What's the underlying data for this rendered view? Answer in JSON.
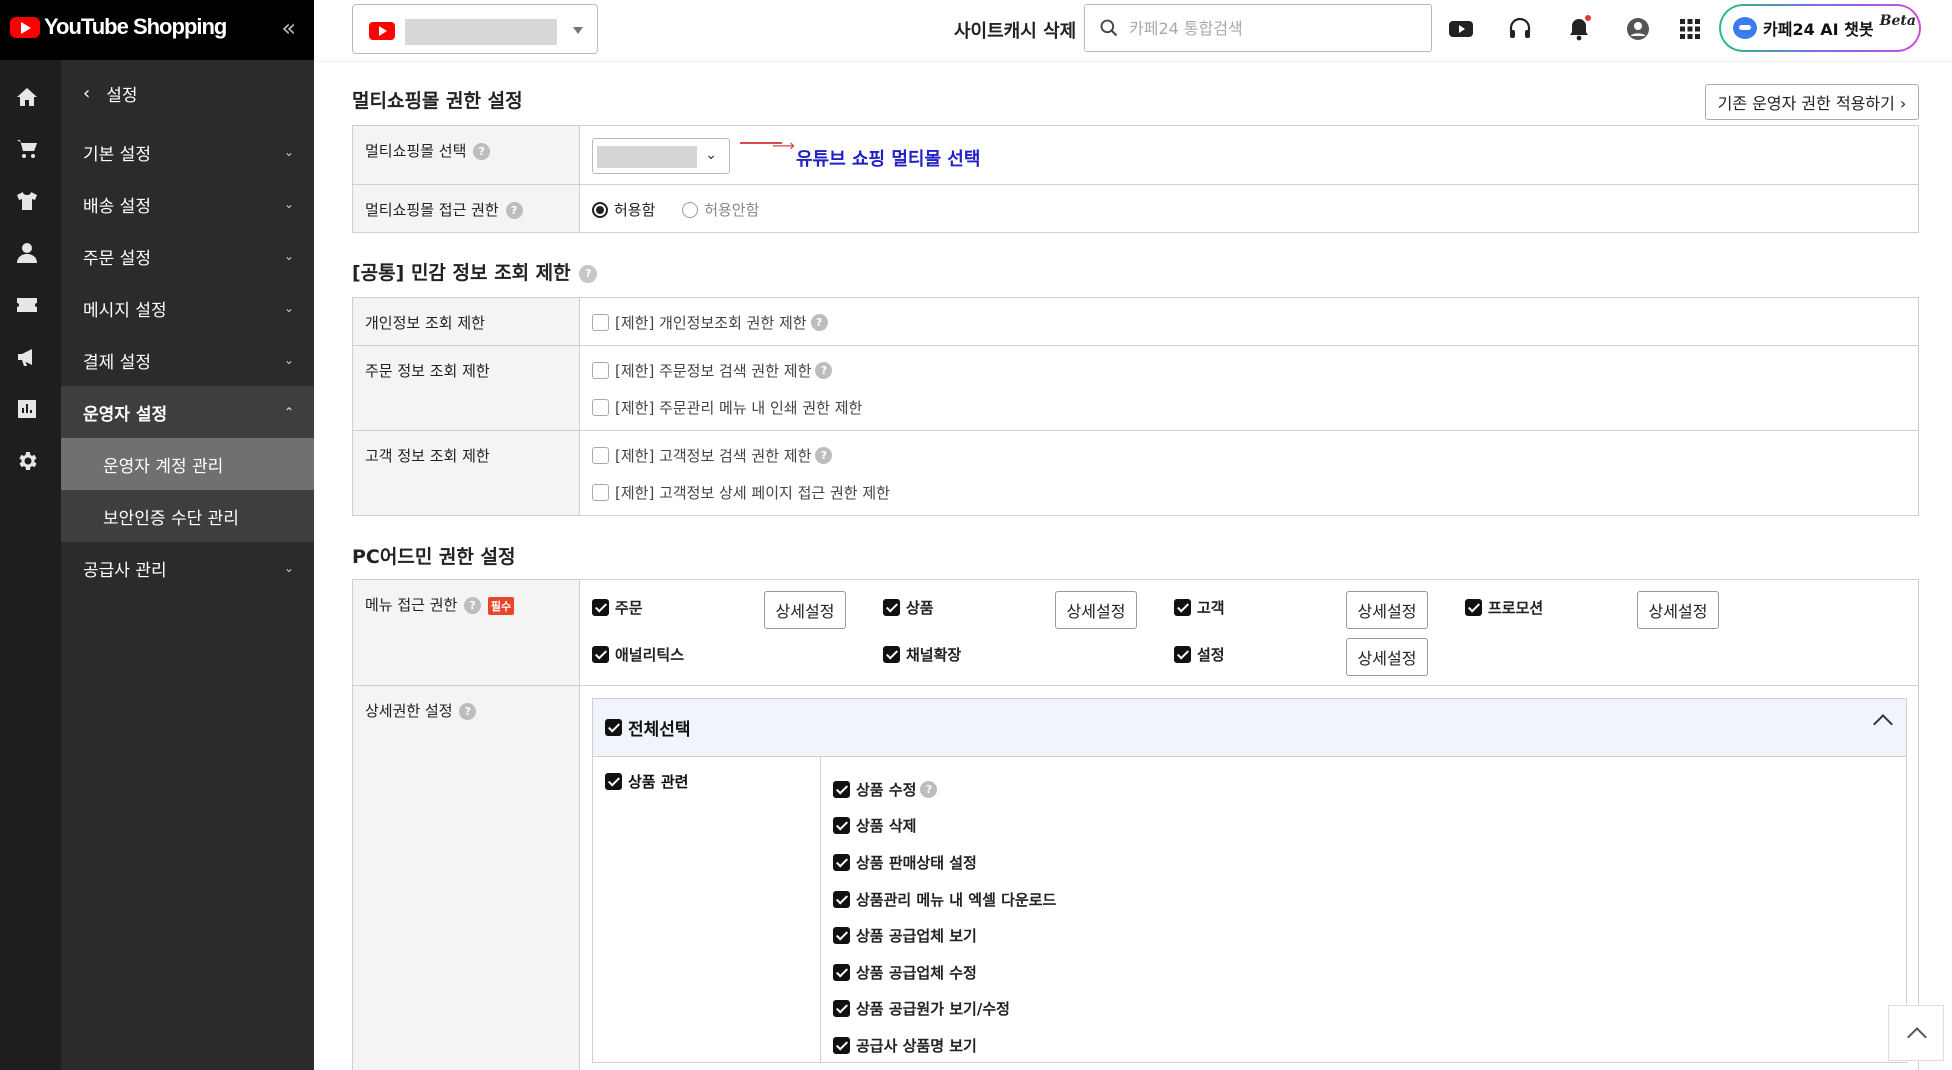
{
  "brand": {
    "name": "YouTube Shopping"
  },
  "sidebar": {
    "back_label": "설정",
    "rail_icons": [
      "home-icon",
      "cart-icon",
      "shirt-icon",
      "person-icon",
      "coupon-icon",
      "megaphone-icon",
      "chart-icon",
      "settings-icon"
    ],
    "items": [
      {
        "label": "기본 설정"
      },
      {
        "label": "배송 설정"
      },
      {
        "label": "주문 설정"
      },
      {
        "label": "메시지 설정"
      },
      {
        "label": "결제 설정"
      },
      {
        "label": "운영자 설정"
      },
      {
        "label": "공급사 관리"
      }
    ],
    "subitems": [
      {
        "label": "운영자 계정 관리"
      },
      {
        "label": "보안인증 수단 관리"
      }
    ]
  },
  "topbar": {
    "cache_delete": "사이트캐시 삭제",
    "search_placeholder": "카페24 통합검색",
    "ai_label": "카페24 AI 챗봇",
    "ai_badge": "Beta"
  },
  "section1": {
    "title": "멀티쇼핑몰 권한 설정",
    "apply_button": "기존 운영자 권한 적용하기 ›",
    "rows": {
      "mall_select": {
        "label": "멀티쇼핑몰 선택",
        "annotation": "유튜브 쇼핑 멀티몰 선택"
      },
      "access": {
        "label": "멀티쇼핑몰 접근 권한",
        "allow": "허용함",
        "deny": "허용안함"
      }
    }
  },
  "section2": {
    "title": "[공통] 민감 정보 조회 제한",
    "rows": [
      {
        "label": "개인정보 조회 제한",
        "options": [
          "[제한] 개인정보조회 권한 제한"
        ]
      },
      {
        "label": "주문 정보 조회 제한",
        "options": [
          "[제한] 주문정보 검색 권한 제한",
          "[제한] 주문관리 메뉴 내 인쇄 권한 제한"
        ]
      },
      {
        "label": "고객 정보 조회 제한",
        "options": [
          "[제한] 고객정보 검색 권한 제한",
          "[제한] 고객정보 상세 페이지 접근 권한 제한"
        ]
      }
    ]
  },
  "section3": {
    "title": "PC어드민 권한 설정",
    "menu_access": {
      "label": "메뉴 접근 권한",
      "required": "필수",
      "detail_label": "상세설정",
      "items": [
        {
          "label": "주문"
        },
        {
          "label": "상품"
        },
        {
          "label": "고객"
        },
        {
          "label": "프로모션"
        },
        {
          "label": "애널리틱스"
        },
        {
          "label": "채널확장"
        },
        {
          "label": "설정"
        }
      ]
    },
    "detail_perm": {
      "label": "상세권한 설정",
      "select_all": "전체선택",
      "category": "상품 관련",
      "perms": [
        "상품 수정",
        "상품 삭제",
        "상품 판매상태 설정",
        "상품관리 메뉴 내 엑셀 다운로드",
        "상품 공급업체 보기",
        "상품 공급업체 수정",
        "상품 공급원가 보기/수정",
        "공급사 상품명 보기"
      ]
    }
  }
}
